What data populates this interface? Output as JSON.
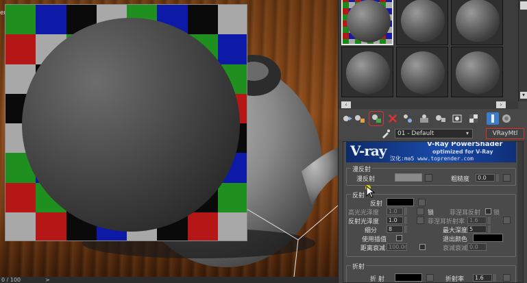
{
  "viewport": {
    "edge_text": "er",
    "status_left": "0 / 100",
    "status_arrow": ">"
  },
  "preview": {
    "checker_colors": [
      "#0a0a0a",
      "#0d1aa8",
      "#b51717",
      "#a8a8a8",
      "#1f8f1f"
    ]
  },
  "material_editor": {
    "slot_count": 6,
    "active_slot": 1,
    "toolbar_icons": [
      "get-material-icon",
      "put-to-scene-icon",
      "assign-to-selection-icon",
      "delete-icon",
      "make-unique-icon",
      "put-to-library-icon",
      "material-id-channel-icon",
      "show-shaded-icon",
      "show-in-viewport-icon",
      "show-end-result-icon",
      "go-to-parent-icon"
    ],
    "material_name": "01 - Default",
    "material_type": "VRayMtl",
    "banner": {
      "logo": "V-ray",
      "headline": "V-Ray PowerShader",
      "subtitle": "optimized for V-Ray",
      "credit": "汉化:ma5 www.toprender.com"
    },
    "diffuse": {
      "group": "漫反射",
      "diffuse_label": "漫反射",
      "roughness_label": "粗糙度",
      "roughness_value": "0.0"
    },
    "reflection": {
      "group": "反射",
      "reflect_label": "反射",
      "hilight_gloss_label": "高光光泽度",
      "hilight_gloss_value": "1.0",
      "lock_label": "锁",
      "fresnel_label": "菲涅耳反射",
      "refl_gloss_label": "反射光泽度",
      "refl_gloss_value": "1.0",
      "fresnel_ior_label": "菲涅耳折射率",
      "fresnel_ior_value": "1.6",
      "subdivs_label": "细分",
      "subdivs_value": "8",
      "max_depth_label": "最大深度",
      "max_depth_value": "5",
      "interp_label": "使用插值",
      "exit_color_label": "退出颜色",
      "dim_dist_label": "距离衰减",
      "dim_dist_value": "100.0r",
      "dim_falloff_label": "衰减衰减",
      "dim_falloff_value": "0.0"
    },
    "refraction": {
      "group": "折射",
      "refract_label": "折 射",
      "ior_label": "折射率",
      "ior_value": "1.6"
    }
  }
}
